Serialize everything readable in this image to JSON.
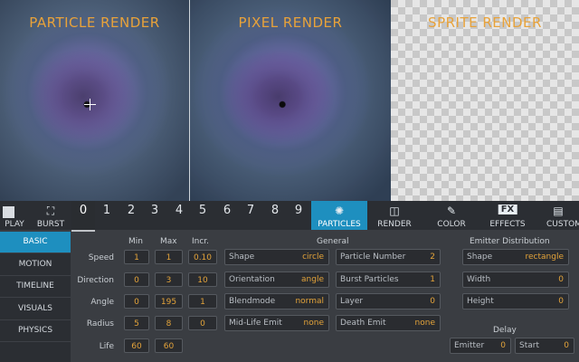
{
  "previews": [
    {
      "title": "PARTICLE RENDER"
    },
    {
      "title": "PIXEL RENDER"
    },
    {
      "title": "SPRITE RENDER"
    }
  ],
  "toolbar": {
    "play_label": "PLAY",
    "burst_label": "BURST",
    "numbers": [
      "0",
      "1",
      "2",
      "3",
      "4",
      "5",
      "6",
      "7",
      "8",
      "9"
    ],
    "active_number": "0",
    "modes": [
      {
        "label": "PARTICLES",
        "icon": "particles-icon",
        "active": true
      },
      {
        "label": "RENDER",
        "icon": "render-icon",
        "active": false
      },
      {
        "label": "COLOR",
        "icon": "color-icon",
        "active": false
      },
      {
        "label": "EFFECTS",
        "icon": "fx-icon",
        "active": false
      },
      {
        "label": "CUSTOM",
        "icon": "custom-icon",
        "active": false
      }
    ]
  },
  "nav": [
    "BASIC",
    "MOTION",
    "TIMELINE",
    "VISUALS",
    "PHYSICS"
  ],
  "basic": {
    "headers": {
      "min": "Min",
      "max": "Max",
      "incr": "Incr."
    },
    "rows": [
      {
        "label": "Speed",
        "min": "1",
        "max": "1",
        "incr": "0.10"
      },
      {
        "label": "Direction",
        "min": "0",
        "max": "3",
        "incr": "10"
      },
      {
        "label": "Angle",
        "min": "0",
        "max": "195",
        "incr": "1"
      },
      {
        "label": "Radius",
        "min": "5",
        "max": "8",
        "incr": "0"
      },
      {
        "label": "Life",
        "min": "60",
        "max": "60",
        "incr": ""
      }
    ]
  },
  "general": {
    "title": "General",
    "left": [
      {
        "key": "Shape",
        "value": "circle"
      },
      {
        "key": "Orientation",
        "value": "angle"
      },
      {
        "key": "Blendmode",
        "value": "normal"
      },
      {
        "key": "Mid-Life Emit",
        "value": "none"
      }
    ],
    "right": [
      {
        "key": "Particle Number",
        "value": "2"
      },
      {
        "key": "Burst Particles",
        "value": "1"
      },
      {
        "key": "Layer",
        "value": "0"
      },
      {
        "key": "Death Emit",
        "value": "none"
      }
    ]
  },
  "emitter": {
    "title": "Emitter Distribution",
    "fields": [
      {
        "key": "Shape",
        "value": "rectangle"
      },
      {
        "key": "Width",
        "value": "0"
      },
      {
        "key": "Height",
        "value": "0"
      }
    ]
  },
  "delay": {
    "title": "Delay",
    "emitter": {
      "key": "Emitter",
      "value": "0"
    },
    "start": {
      "key": "Start",
      "value": "0"
    }
  }
}
